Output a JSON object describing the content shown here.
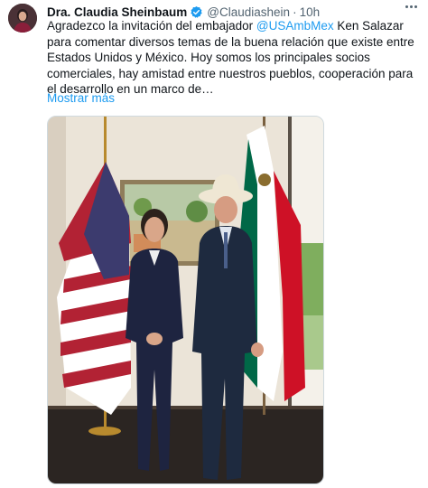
{
  "tweet": {
    "author_name": "Dra. Claudia Sheinbaum",
    "handle": "@Claudiashein",
    "separator": "·",
    "time": "10h",
    "text_parts": [
      "Agradezco la invitación del embajador ",
      "@USAmbMex",
      " Ken Salazar para comentar diversos temas de la buena relación que existe entre Estados Unidos y México. Hoy somos los principales socios comerciales, hay amistad entre nuestros pueblos, cooperación para el desarrollo en un marco de…"
    ],
    "show_more": "Mostrar más"
  },
  "icons": {
    "verified": "verified-badge-icon",
    "more": "more-options-icon"
  },
  "colors": {
    "link": "#1d9bf0",
    "secondary_text": "#536471",
    "verified": "#1d9bf0"
  }
}
